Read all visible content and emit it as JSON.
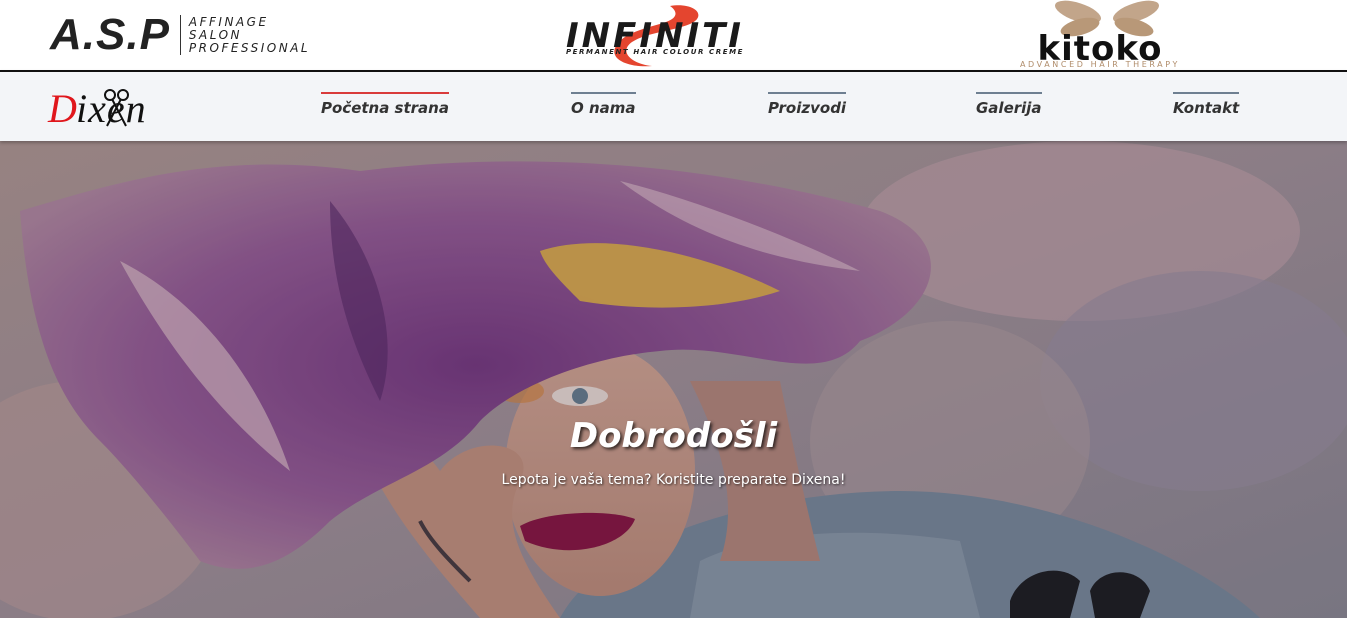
{
  "brands": {
    "asp": {
      "mark": "A.S.P",
      "lines": [
        "AFFINAGE",
        "SALON",
        "PROFESSIONAL"
      ]
    },
    "infiniti": {
      "mark": "INFINITI",
      "tagline": "PERMANENT HAIR COLOUR CREME",
      "accent": "#e4452f"
    },
    "kitoko": {
      "mark": "kitoko",
      "tagline": "ADVANCED HAIR THERAPY",
      "accent": "#b08c6a"
    }
  },
  "logo": {
    "initial": "D",
    "rest": "ixen",
    "accent": "#e0161c",
    "icon": "scissors-icon"
  },
  "nav": {
    "items": [
      {
        "label": "Početna strana",
        "active": true
      },
      {
        "label": "O nama",
        "active": false
      },
      {
        "label": "Proizvodi",
        "active": false
      },
      {
        "label": "Galerija",
        "active": false
      },
      {
        "label": "Kontakt",
        "active": false
      }
    ],
    "active_color": "#d93b3b",
    "inactive_color": "#6e7f91"
  },
  "hero": {
    "title": "Dobrodošli",
    "subtitle": "Lepota je vaša tema? Koristite preparate Dixena!"
  }
}
